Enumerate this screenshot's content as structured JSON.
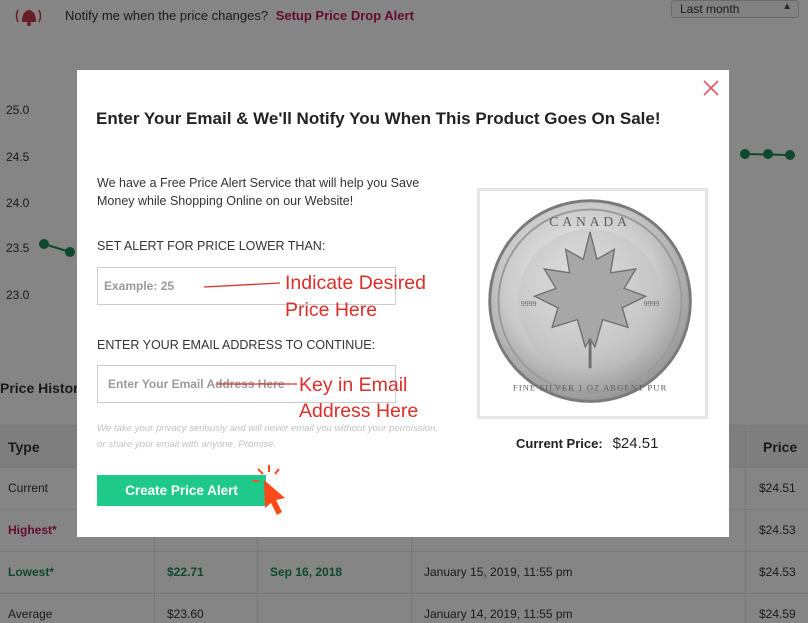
{
  "topbar": {
    "notify_text": "Notify me when the price changes?",
    "notify_link": "Setup Price Drop Alert",
    "range_selected": "Last month"
  },
  "chart": {
    "y_ticks": [
      "25.0",
      "24.5",
      "24.0",
      "23.5",
      "23.0"
    ]
  },
  "price_history": {
    "title": "Price History",
    "headers": [
      "Type",
      "Price"
    ],
    "rows": [
      {
        "type": "Current",
        "price": "$24.51",
        "extra": [
          "",
          "",
          ""
        ]
      },
      {
        "type": "Highest*",
        "price": "$24.53",
        "extra": [
          "",
          "",
          ""
        ]
      },
      {
        "type": "Lowest*",
        "price": "$24.53",
        "extra": [
          "$22.71",
          "Sep 16, 2018",
          "January 15, 2019, 11:55 pm"
        ]
      },
      {
        "type": "Average",
        "price": "$24.59",
        "extra": [
          "$23.60",
          "",
          "January 14, 2019, 11:55 pm"
        ]
      }
    ]
  },
  "modal": {
    "title": "Enter Your Email & We'll Notify You When This Product Goes On Sale!",
    "intro": "We have a Free Price Alert Service that will help you Save Money while Shopping Online on our Website!",
    "price_label": "SET ALERT FOR PRICE LOWER THAN:",
    "price_placeholder": "Example: 25",
    "email_label": "ENTER YOUR EMAIL ADDRESS TO CONTINUE:",
    "email_placeholder": "Enter Your Email Address Here",
    "privacy": "We take your privacy seriously and will never email you without your permission, or share your email with anyone. Promise.",
    "button": "Create Price Alert",
    "annotation_price": "Indicate Desired Price Here",
    "annotation_email": "Key in Email Address Here",
    "current_price_label": "Current Price:",
    "current_price_value": "$24.51",
    "coin_text": "CANADA · FINE SILVER 1 OZ ARGENT PUR · 9999"
  },
  "colors": {
    "accent_green": "#1ec98a",
    "link_pink": "#c2185b",
    "annotation_red": "#d9302b",
    "series_green": "#1a8a5a"
  }
}
